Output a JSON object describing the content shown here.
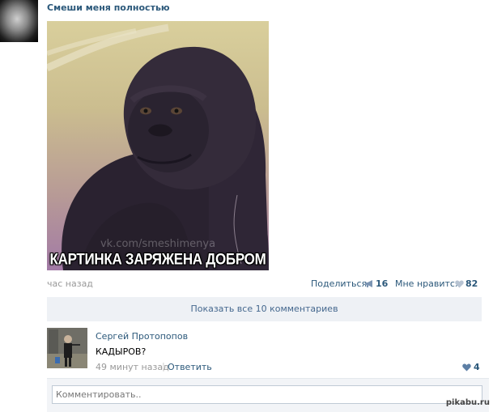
{
  "post": {
    "author": "Смеши меня полностью",
    "meme_watermark": "vk.com/smeshimenya",
    "meme_caption": "КАРТИНКА ЗАРЯЖЕНА ДОБРОМ",
    "time": "час назад",
    "share_label": "Поделиться",
    "share_count": "16",
    "like_label": "Мне нравится",
    "like_count": "82"
  },
  "comments_bar": {
    "label": "Показать все 10 комментариев"
  },
  "comment": {
    "author": "Сергей Протопопов",
    "text": "КАДЫРОВ?",
    "time": "49 минут назад",
    "separator": "|",
    "reply_label": "Ответить",
    "like_count": "4"
  },
  "comment_input": {
    "placeholder": "Комментировать.."
  },
  "site_watermark": "pikabu.ru",
  "colors": {
    "link": "#2b587a",
    "muted": "#999999",
    "bar_bg": "#eef1f5",
    "heart": "#7c95b3"
  },
  "icons": {
    "share": "megaphone-icon",
    "like": "heart-icon"
  }
}
